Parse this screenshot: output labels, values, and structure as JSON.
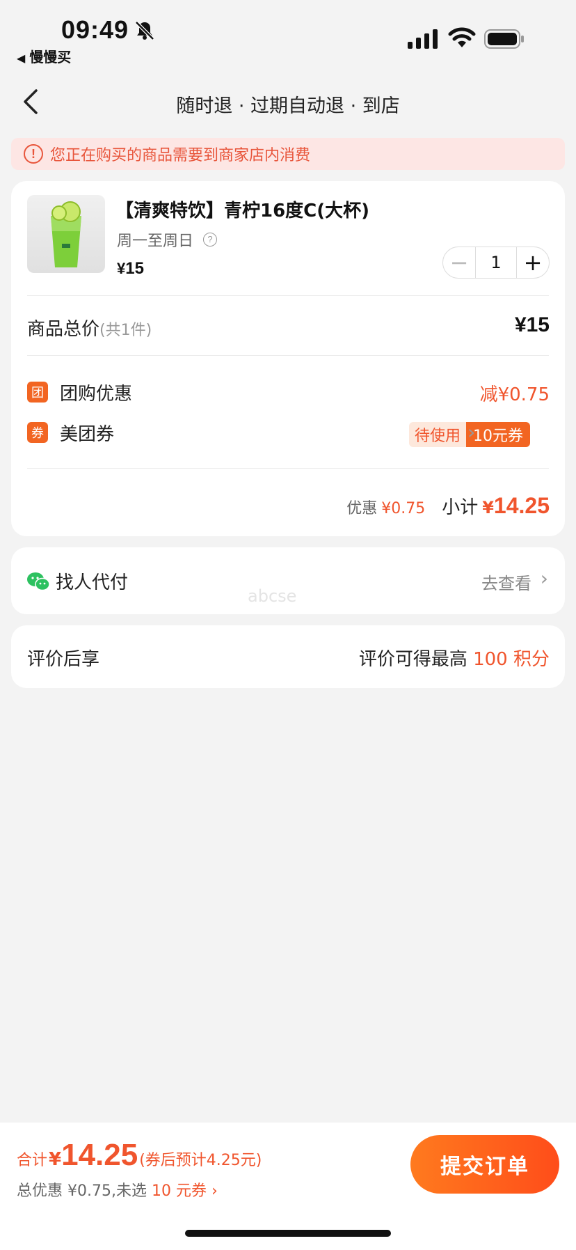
{
  "status": {
    "time": "09:49",
    "back_app": "慢慢买"
  },
  "nav": {
    "title": "随时退 · 过期自动退 · 到店"
  },
  "notice": {
    "icon": "!",
    "text": "您正在购买的商品需要到商家店内消费"
  },
  "product": {
    "name": "【清爽特饮】青柠16度C(大杯)",
    "days": "周一至周日",
    "help_icon": "?",
    "currency": "¥",
    "price": "15",
    "quantity": "1",
    "minus": "−",
    "plus": "+"
  },
  "summary": {
    "total_label": "商品总价",
    "total_count": "(共1件)",
    "total_value": "¥15",
    "group_icon": "团",
    "group_label": "团购优惠",
    "group_value": "减¥0.75",
    "coupon_icon": "券",
    "coupon_label": "美团券",
    "coupon_pending": "待使用",
    "coupon_amount": "10元券",
    "save_label": "优惠",
    "save_value": "¥0.75",
    "subtotal_label": "小计",
    "subtotal_currency": "¥",
    "subtotal_value": "14.25"
  },
  "pay": {
    "label": "找人代付",
    "link": "去查看",
    "watermark": "abcse"
  },
  "review": {
    "label": "评价后享",
    "prefix": "评价可得最高",
    "points": "100 积分"
  },
  "bottom": {
    "sum_label": "合计",
    "sum_currency": "¥",
    "sum_value": "14.25",
    "sum_note": "(券后预计4.25元)",
    "sub_prefix": "总优惠 ¥0.75,未选",
    "sub_coupon": "10 元券 ›",
    "submit": "提交订单"
  },
  "colors": {
    "accent": "#f0552d",
    "button": "#ff5a1a",
    "notice_bg": "#fde6e4"
  }
}
